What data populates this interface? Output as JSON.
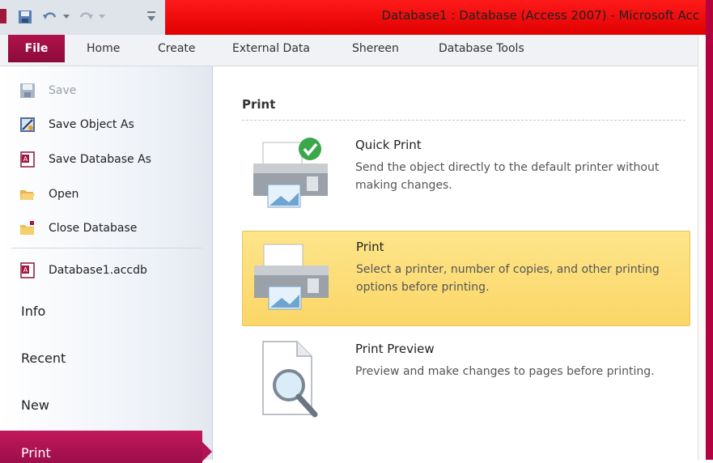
{
  "window": {
    "title": "Database1 : Database (Access 2007)  -  Microsoft Acc"
  },
  "tabs": {
    "file": "File",
    "items": [
      "Home",
      "Create",
      "External Data",
      "Shereen",
      "Database Tools"
    ]
  },
  "nav": {
    "save": "Save",
    "save_object_as": "Save Object As",
    "save_database_as": "Save Database As",
    "open": "Open",
    "close_database": "Close Database",
    "recent_file": "Database1.accdb",
    "info": "Info",
    "recent": "Recent",
    "new": "New",
    "print": "Print"
  },
  "print_panel": {
    "heading": "Print",
    "options": [
      {
        "title": "Quick Print",
        "desc": "Send the object directly to the default printer without making changes."
      },
      {
        "title": "Print",
        "desc": "Select a printer, number of copies, and other printing options before printing."
      },
      {
        "title": "Print Preview",
        "desc": "Preview and make changes to pages before printing."
      }
    ]
  },
  "colors": {
    "accent": "#a50e45",
    "title_red": "#ff0000",
    "selected_bg": "#fde58a"
  }
}
